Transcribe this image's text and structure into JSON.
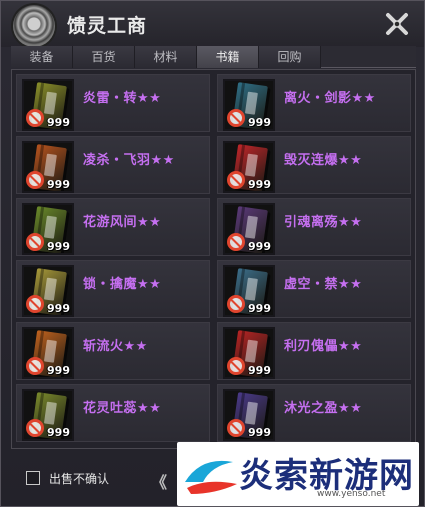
{
  "window": {
    "title": "馈灵工商"
  },
  "tabs": [
    {
      "label": "装备",
      "active": false
    },
    {
      "label": "百货",
      "active": false
    },
    {
      "label": "材料",
      "active": false
    },
    {
      "label": "书籍",
      "active": true
    },
    {
      "label": "回购",
      "active": false
    }
  ],
  "items": [
    {
      "name": "炎雷・转★★",
      "count": "999",
      "book_color": "#8a8f2a"
    },
    {
      "name": "离火・剑影★★",
      "count": "999",
      "book_color": "#2f6f86"
    },
    {
      "name": "凌杀・飞羽★★",
      "count": "999",
      "book_color": "#b6531e"
    },
    {
      "name": "毁灭连爆★★",
      "count": "999",
      "book_color": "#c0262a"
    },
    {
      "name": "花游风间★★",
      "count": "999",
      "book_color": "#6a8a2a"
    },
    {
      "name": "引魂离殇★★",
      "count": "999",
      "book_color": "#5b3a7a"
    },
    {
      "name": "锁・擒魔★★",
      "count": "999",
      "book_color": "#a89a3a"
    },
    {
      "name": "虚空・禁★★",
      "count": "999",
      "book_color": "#3b6e8a"
    },
    {
      "name": "斩流火★★",
      "count": "999",
      "book_color": "#c0621e"
    },
    {
      "name": "利刃傀儡★★",
      "count": "999",
      "book_color": "#b82424"
    },
    {
      "name": "花灵吐蕊★★",
      "count": "999",
      "book_color": "#7a8a2c"
    },
    {
      "name": "沐光之盈★★",
      "count": "999",
      "book_color": "#4a3a8a"
    }
  ],
  "footer": {
    "confirm_label": "出售不确认",
    "prev_glyph": "《"
  },
  "watermark": {
    "text": "炎索新游网",
    "url": "www.yenso.net"
  },
  "colors": {
    "item_name": "#c56ff0",
    "forbid": "#e0452e"
  }
}
